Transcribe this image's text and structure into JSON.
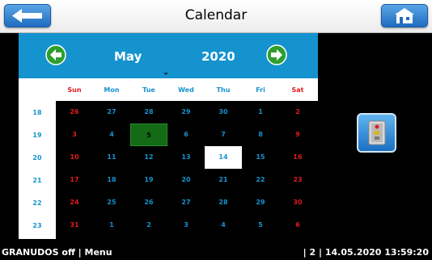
{
  "window": {
    "title": "Calendar"
  },
  "icons": {
    "back": "back-arrow-icon",
    "home": "home-icon",
    "prev": "chevron-left-icon",
    "next": "chevron-right-icon",
    "side": "device-panel-icon"
  },
  "colors": {
    "accent": "#1593cf",
    "weekend": "#e21b1b",
    "selected": "#136b16",
    "background": "#000000"
  },
  "calendar": {
    "month": "May",
    "year": "2020",
    "weekdays": [
      "Sun",
      "Mon",
      "Tue",
      "Wed",
      "Thu",
      "Fri",
      "Sat"
    ],
    "week_numbers": [
      "18",
      "19",
      "20",
      "21",
      "22",
      "23"
    ],
    "weeks": [
      [
        "26",
        "27",
        "28",
        "29",
        "30",
        "1",
        "2"
      ],
      [
        "3",
        "4",
        "5",
        "6",
        "7",
        "8",
        "9"
      ],
      [
        "10",
        "11",
        "12",
        "13",
        "14",
        "15",
        "16"
      ],
      [
        "17",
        "18",
        "19",
        "20",
        "21",
        "22",
        "23"
      ],
      [
        "24",
        "25",
        "26",
        "27",
        "28",
        "29",
        "30"
      ],
      [
        "31",
        "1",
        "2",
        "3",
        "4",
        "5",
        "6"
      ]
    ],
    "selected_day": "5",
    "today": "14"
  },
  "status": {
    "left": "GRANUDOS off | Menu",
    "right": "| 2 | 14.05.2020 13:59:20"
  }
}
